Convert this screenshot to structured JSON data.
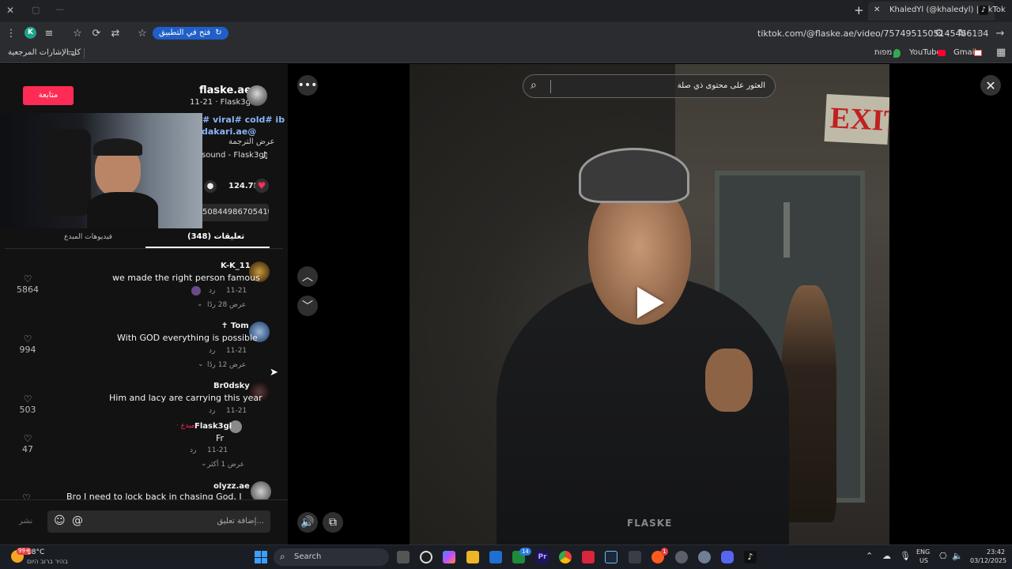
{
  "tab": {
    "title": "KhaledYl (@khaledyl) | TikTok",
    "new_tab": "+",
    "close": "✕"
  },
  "window_controls": {
    "close": "✕",
    "restore": "▢",
    "minimize": "—"
  },
  "toolbar": {
    "url": "tiktok.com/@flaske.ae/video/7574951505145466134",
    "open_app_label": "فتح في التطبيق",
    "profile_initial": "K"
  },
  "bookmarks": {
    "all_bookmarks": "كل الإشارات المرجعية",
    "items": [
      "Gmail",
      "YouTube",
      "מפות"
    ]
  },
  "search": {
    "placeholder": "العثور على محتوى ذي صلة"
  },
  "post": {
    "author": "flaske.ae",
    "sub": "11-21 · Flask3gl",
    "follow_label": "متابعة",
    "caption_line1": "# viral# cold# ib",
    "caption_line2": "dakari.ae@",
    "translate": "عرض الترجمة",
    "sound": "sound - Flask3gl",
    "likes": "124.7K",
    "link_fragment": "5084498670541б"
  },
  "tabs": {
    "comments": "تعليقات (348)",
    "creator_videos": "فيديوهات المبدع"
  },
  "comments": [
    {
      "name": "K-K_11",
      "text": "we made the right person famous",
      "date": "11-21",
      "reply": "رد",
      "likes": "5864",
      "view_replies": "عرض 28 ردًا"
    },
    {
      "name": "✝ Tom",
      "text": "With GOD everything is possible",
      "date": "11-21",
      "reply": "رد",
      "likes": "994",
      "view_replies": "عرض 12 ردًا"
    },
    {
      "name": "Br0dsky",
      "text": "Him and lacy are carrying this year",
      "date": "11-21",
      "reply": "رد",
      "likes": "503",
      "view_replies": ""
    },
    {
      "name": "Flask3gl",
      "creator_tag": "· مبدع",
      "text": "Fr",
      "date": "11-21",
      "reply": "رد",
      "likes": "47",
      "view_replies": "عرض 1 أكثر"
    },
    {
      "name": "olyzz.ae",
      "text": "Bro I need to lock back in chasing God, I have",
      "date": "",
      "reply": "",
      "likes": "",
      "view_replies": ""
    }
  ],
  "composer": {
    "placeholder": "إضافة تعليق...",
    "post_label": "نشر"
  },
  "video": {
    "watermark": "FLASKE",
    "exit_sign": "EXIT"
  },
  "taskbar": {
    "weather_temp": "18°C",
    "weather_desc": "בהיר ברוב היום",
    "search_label": "Search",
    "lang_top": "ENG",
    "lang_bottom": "US",
    "time": "23:42",
    "date": "03/12/2025",
    "badge_14": "14",
    "badge_1": "1",
    "badge_99": "99+"
  },
  "colors": {
    "accent": "#fe2c55",
    "link": "#8ab4f8",
    "chrome_bg": "#202124"
  }
}
